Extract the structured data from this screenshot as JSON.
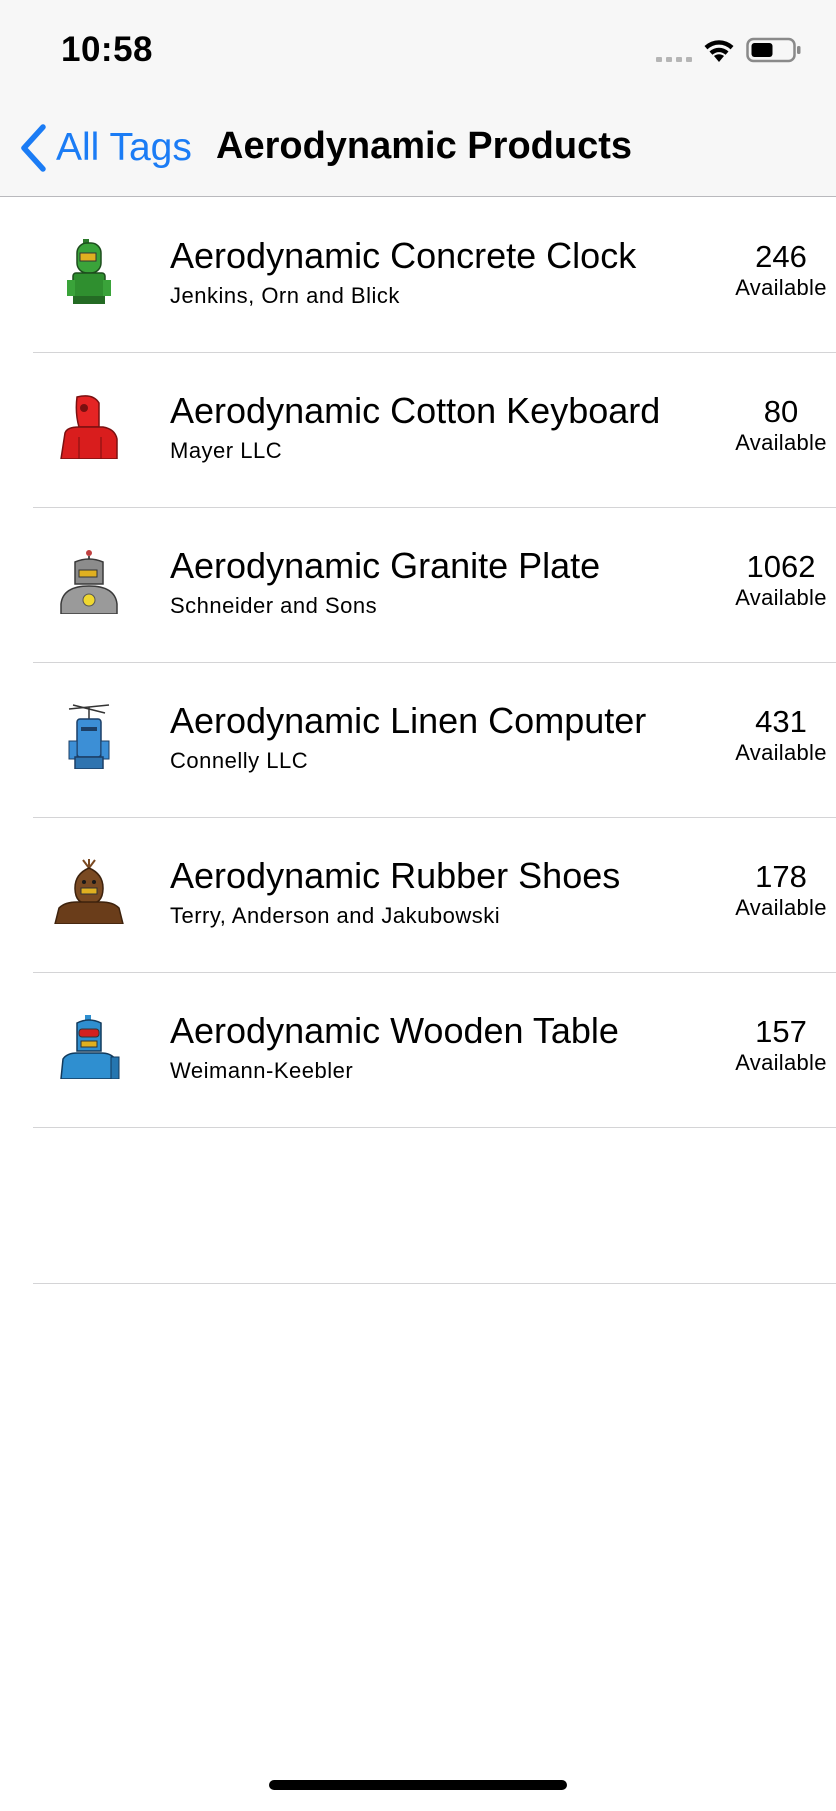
{
  "status_bar": {
    "time": "10:58"
  },
  "nav": {
    "back_label": "All Tags",
    "title": "Aerodynamic Products"
  },
  "accent_color": "#1b7cf5",
  "products": [
    {
      "name": "Aerodynamic Concrete Clock",
      "brand": "Jenkins, Orn and Blick",
      "quantity": "246",
      "quantity_label": "Available",
      "avatar_color": "#3aa33a"
    },
    {
      "name": "Aerodynamic Cotton Keyboard",
      "brand": "Mayer LLC",
      "quantity": "80",
      "quantity_label": "Available",
      "avatar_color": "#e52424"
    },
    {
      "name": "Aerodynamic Granite Plate",
      "brand": "Schneider and Sons",
      "quantity": "1062",
      "quantity_label": "Available",
      "avatar_color": "#8c8c8c"
    },
    {
      "name": "Aerodynamic Linen Computer",
      "brand": "Connelly LLC",
      "quantity": "431",
      "quantity_label": "Available",
      "avatar_color": "#3c8fd6"
    },
    {
      "name": "Aerodynamic Rubber Shoes",
      "brand": "Terry, Anderson and Jakubowski",
      "quantity": "178",
      "quantity_label": "Available",
      "avatar_color": "#7a4a22"
    },
    {
      "name": "Aerodynamic Wooden Table",
      "brand": "Weimann-Keebler",
      "quantity": "157",
      "quantity_label": "Available",
      "avatar_color": "#2f8fd0"
    }
  ]
}
